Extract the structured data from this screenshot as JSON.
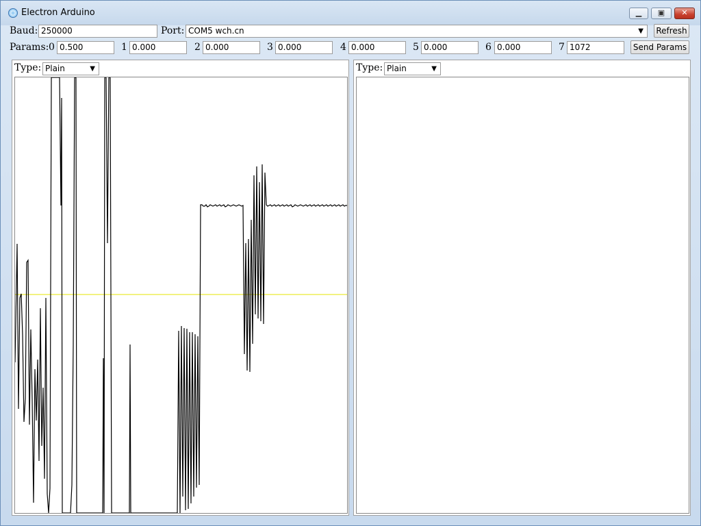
{
  "window": {
    "title": "Electron Arduino"
  },
  "toolbar": {
    "baud_label": "Baud:",
    "baud_value": "250000",
    "port_label": "Port:",
    "port_value": "COM5 wch.cn",
    "refresh_label": "Refresh"
  },
  "params": {
    "label": "Params:",
    "items": [
      {
        "index": "0",
        "value": "0.500"
      },
      {
        "index": "1",
        "value": "0.000"
      },
      {
        "index": "2",
        "value": "0.000"
      },
      {
        "index": "3",
        "value": "0.000"
      },
      {
        "index": "4",
        "value": "0.000"
      },
      {
        "index": "5",
        "value": "0.000"
      },
      {
        "index": "6",
        "value": "0.000"
      },
      {
        "index": "7",
        "value": "1072"
      }
    ],
    "send_label": "Send Params"
  },
  "left_panel": {
    "type_label": "Type:",
    "type_value": "Plain"
  },
  "right_panel": {
    "type_label": "Type:",
    "type_value": "Plain"
  },
  "colors": {
    "signal": "#000000",
    "reference": "#e6e600"
  }
}
